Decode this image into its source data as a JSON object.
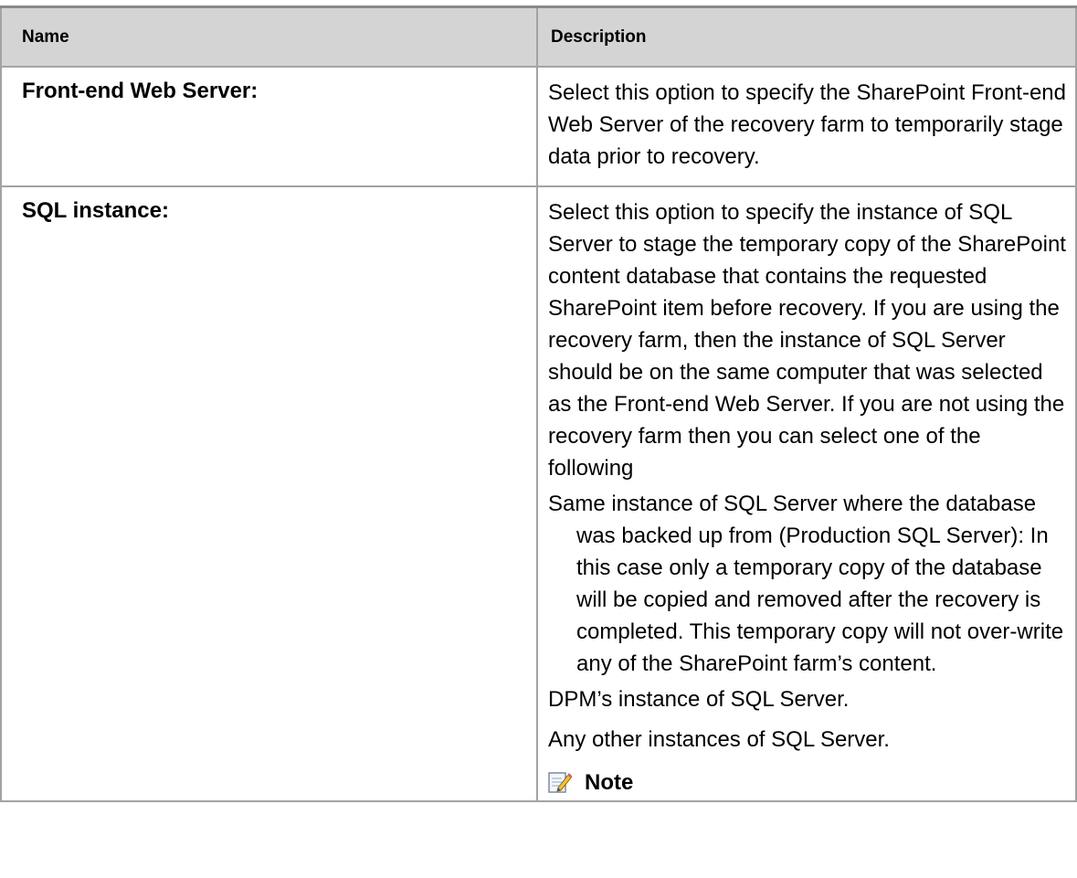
{
  "table": {
    "headers": {
      "name": "Name",
      "description": "Description"
    },
    "rows": [
      {
        "name": "Front-end Web Server:",
        "description": "Select this option to specify the SharePoint Front-end Web Server of the recovery farm to temporarily stage data prior to recovery."
      },
      {
        "name": "SQL instance:",
        "description_intro": "Select this option to specify the instance of SQL Server to stage the temporary copy of the SharePoint content database that contains the requested SharePoint item before recovery. If you are using the recovery farm, then the instance of SQL Server should be on the same computer that was selected as the Front-end Web Server. If you are not using the recovery farm then you can select one of the following",
        "options": [
          "Same instance of SQL Server where the database was backed up from (Production SQL Server): In this case only a temporary copy of the database will be copied and removed after the recovery is completed. This temporary copy will not over-write any of the SharePoint farm’s content.",
          "DPM’s instance of SQL Server.",
          "Any other instances of SQL Server."
        ],
        "note_label": "Note",
        "note_icon": "note-pencil-icon"
      }
    ]
  }
}
